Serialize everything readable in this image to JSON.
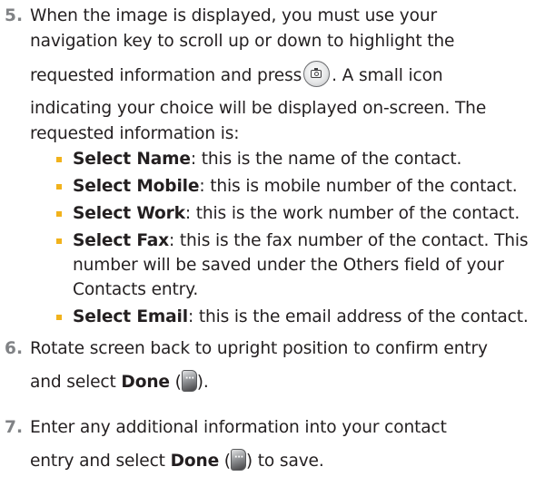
{
  "steps": [
    {
      "number": "5.",
      "lines": [
        "When the image is displayed, you must use your",
        "navigation key to scroll up or down to highlight the",
        "requested information and press",
        ". A small icon",
        "indicating your choice will be displayed on-screen. The",
        "requested information is:"
      ],
      "icon": "camera-key-icon",
      "bullets": [
        {
          "term": "Select Name",
          "lines": [
            ": this is the name of the contact."
          ]
        },
        {
          "term": "Select Mobile",
          "lines": [
            ": this is mobile number of the contact."
          ]
        },
        {
          "term": "Select Work",
          "lines": [
            ": this is the work number of the contact."
          ]
        },
        {
          "term": "Select Fax",
          "lines": [
            ": this is the fax number of the contact. This",
            "number will be saved under the Others field of your",
            "Contacts entry."
          ]
        },
        {
          "term": "Select Email",
          "lines": [
            ": this is the email address of the contact."
          ]
        }
      ]
    },
    {
      "number": "6.",
      "lines": [
        "Rotate screen back to upright position to confirm entry",
        "and select",
        "Done",
        " (",
        ")."
      ],
      "icon": "softkey-icon"
    },
    {
      "number": "7.",
      "lines": [
        "Enter any additional information into your contact",
        "entry and select",
        "Done",
        " (",
        ") to save."
      ],
      "icon": "softkey-icon"
    }
  ],
  "colors": {
    "text": "#231f20",
    "step_number": "#808285",
    "bullet": "#f1b21c"
  }
}
